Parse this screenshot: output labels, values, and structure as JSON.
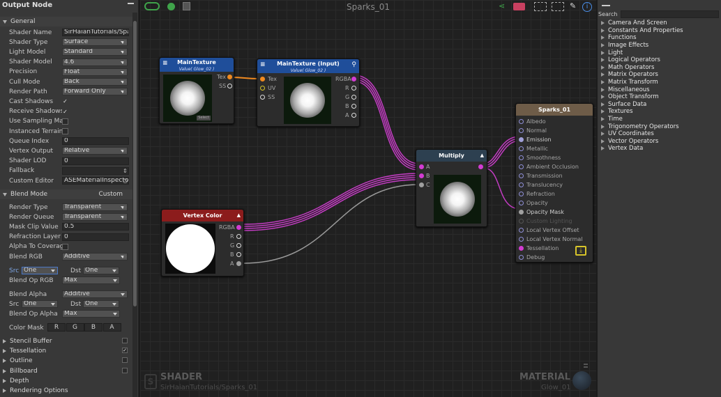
{
  "left_panel": {
    "title": "Output Node",
    "general_label": "General",
    "rows": [
      {
        "label": "Shader Name",
        "value": "SirHaianTutorials/Spark",
        "kind": "text"
      },
      {
        "label": "Shader Type",
        "value": "Surface",
        "kind": "dd"
      },
      {
        "label": "Light Model",
        "value": "Standard",
        "kind": "dd"
      },
      {
        "label": "Shader Model",
        "value": "4.6",
        "kind": "dd"
      },
      {
        "label": "Precision",
        "value": "Float",
        "kind": "dd"
      },
      {
        "label": "Cull Mode",
        "value": "Back",
        "kind": "dd"
      },
      {
        "label": "Render Path",
        "value": "Forward Only",
        "kind": "dd"
      },
      {
        "label": "Cast Shadows",
        "value": "✓",
        "kind": "chk"
      },
      {
        "label": "Receive Shadows",
        "value": "✓",
        "kind": "chk"
      },
      {
        "label": "Use Sampling Mac",
        "value": "",
        "kind": "chkbox"
      },
      {
        "label": "Instanced Terrain",
        "value": "",
        "kind": "chkbox"
      },
      {
        "label": "Queue Index",
        "value": "0",
        "kind": "text"
      },
      {
        "label": "Vertex Output",
        "value": "Relative",
        "kind": "dd"
      },
      {
        "label": "Shader LOD",
        "value": "0",
        "kind": "text"
      },
      {
        "label": "Fallback",
        "value": "",
        "kind": "text"
      },
      {
        "label": "Custom Editor",
        "value": "ASEMaterialInspecto",
        "kind": "text"
      }
    ],
    "blend_mode_label": "Blend Mode",
    "blend_mode_value": "Custom",
    "blend_rows": [
      {
        "label": "Render Type",
        "value": "Transparent",
        "kind": "dd"
      },
      {
        "label": "Render Queue",
        "value": "Transparent",
        "kind": "dd"
      },
      {
        "label": "Mask Clip Value",
        "value": "0.5",
        "kind": "text"
      },
      {
        "label": "Refraction Layer",
        "value": "0",
        "kind": "text"
      },
      {
        "label": "Alpha To Coverage",
        "value": "",
        "kind": "chkbox"
      },
      {
        "label": "Blend RGB",
        "value": "Additive",
        "kind": "dd"
      }
    ],
    "src_label": "Src",
    "src_value": "One",
    "dst_label": "Dst",
    "dst_value": "One",
    "blend_op_rgb_label": "Blend Op RGB",
    "blend_op_rgb_value": "Max",
    "blend_alpha_label": "Blend Alpha",
    "blend_alpha_value": "Additive",
    "src2_value": "One",
    "dst2_value": "One",
    "blend_op_alpha_label": "Blend Op Alpha",
    "blend_op_alpha_value": "Max",
    "color_mask_label": "Color Mask",
    "color_mask": [
      "R",
      "G",
      "B",
      "A"
    ],
    "sections": [
      {
        "label": "Stencil Buffer",
        "checked": ""
      },
      {
        "label": "Tessellation",
        "checked": "✓"
      },
      {
        "label": "Outline",
        "checked": ""
      },
      {
        "label": "Billboard",
        "checked": ""
      },
      {
        "label": "Depth",
        "checked": null
      },
      {
        "label": "Rendering Options",
        "checked": null
      }
    ]
  },
  "canvas": {
    "title": "Sparks_01",
    "shader_label": "SHADER",
    "shader_name": "SirHaianTutorials/Sparks_01",
    "material_label": "MATERIAL",
    "material_name": "Glow_01"
  },
  "nodes": {
    "main_texture": {
      "title": "MainTexture",
      "subtitle": "Value( Glow_02 )",
      "ports": [
        "Tex",
        "SS"
      ],
      "select": "Select"
    },
    "main_texture_input": {
      "title": "MainTexture (Input)",
      "subtitle": "Value( Glow_02 )",
      "in_ports": [
        "Tex",
        "UV",
        "SS"
      ],
      "out_ports": [
        "RGBA",
        "R",
        "G",
        "B",
        "A"
      ]
    },
    "vertex_color": {
      "title": "Vertex Color",
      "out_ports": [
        "RGBA",
        "R",
        "G",
        "B",
        "A"
      ]
    },
    "multiply": {
      "title": "Multiply",
      "in_ports": [
        "A",
        "B",
        "C"
      ]
    },
    "output": {
      "title": "Sparks_01",
      "inputs": [
        "Albedo",
        "Normal",
        "Emission",
        "Metallic",
        "Smoothness",
        "Ambient Occlusion",
        "Transmission",
        "Translucency",
        "Refraction",
        "Opacity",
        "Opacity Mask",
        "Custom Lighting",
        "Local Vertex Offset",
        "Local Vertex Normal",
        "Tessellation",
        "Debug"
      ]
    }
  },
  "right_panel": {
    "search_label": "Search",
    "search_value": "",
    "categories": [
      "Camera And Screen",
      "Constants And Properties",
      "Functions",
      "Image Effects",
      "Light",
      "Logical Operators",
      "Math Operators",
      "Matrix Operators",
      "Matrix Transform",
      "Miscellaneous",
      "Object Transform",
      "Surface Data",
      "Textures",
      "Time",
      "Trigonometry Operators",
      "UV Coordinates",
      "Vector Operators",
      "Vertex Data"
    ]
  },
  "colors": {
    "accent_pink": "#d23cd2",
    "accent_orange": "#f08a20",
    "accent_yellow": "#d7c42a"
  }
}
